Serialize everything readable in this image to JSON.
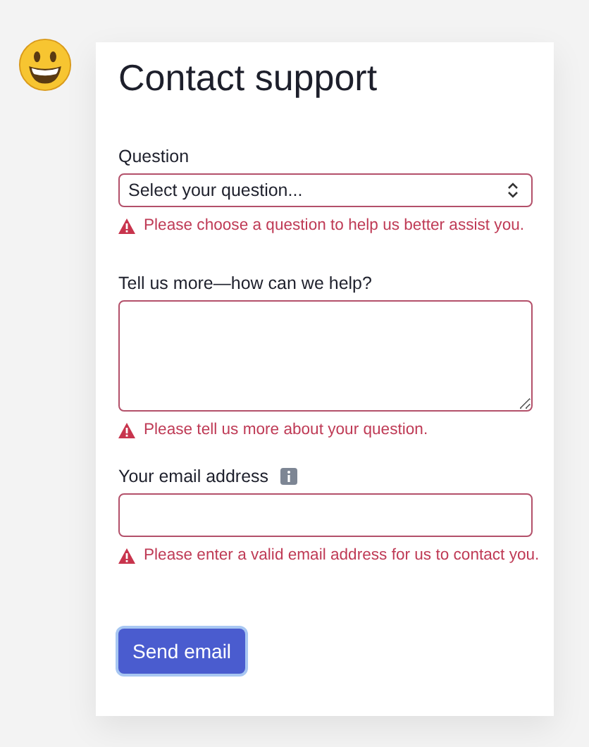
{
  "title": "Contact support",
  "fields": [
    {
      "kind": "select",
      "label": "Question",
      "value": "Select your question...",
      "info": false,
      "error": "Please choose a question to help us better assist you."
    },
    {
      "kind": "textarea",
      "label": "Tell us more—how can we help?",
      "info": false,
      "error": "Please tell us more about your question."
    },
    {
      "kind": "input",
      "label": "Your email address",
      "info": true,
      "error": "Please enter a valid email address for us to contact you."
    }
  ],
  "submit": "Send email"
}
